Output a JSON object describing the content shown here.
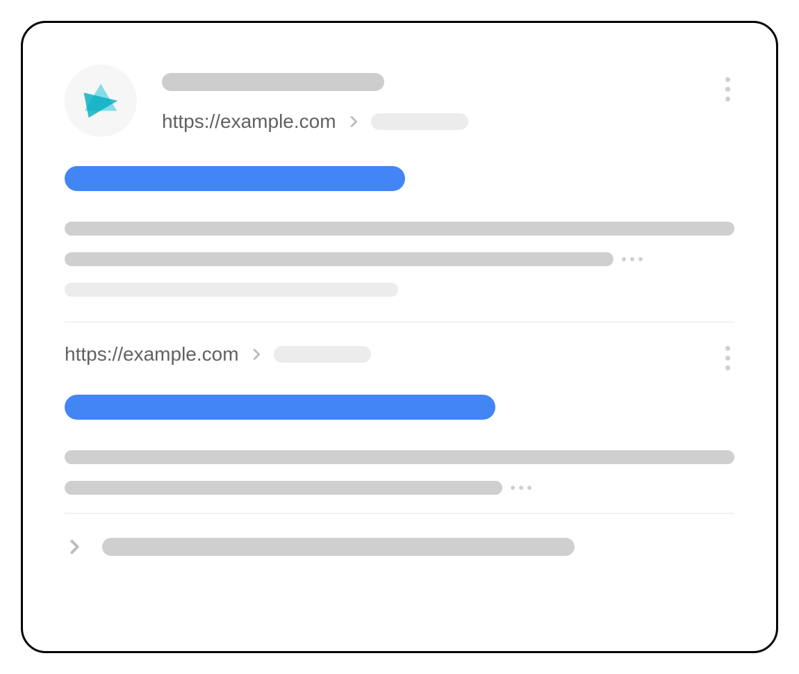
{
  "results": [
    {
      "url": "https://example.com"
    },
    {
      "url": "https://example.com"
    }
  ]
}
